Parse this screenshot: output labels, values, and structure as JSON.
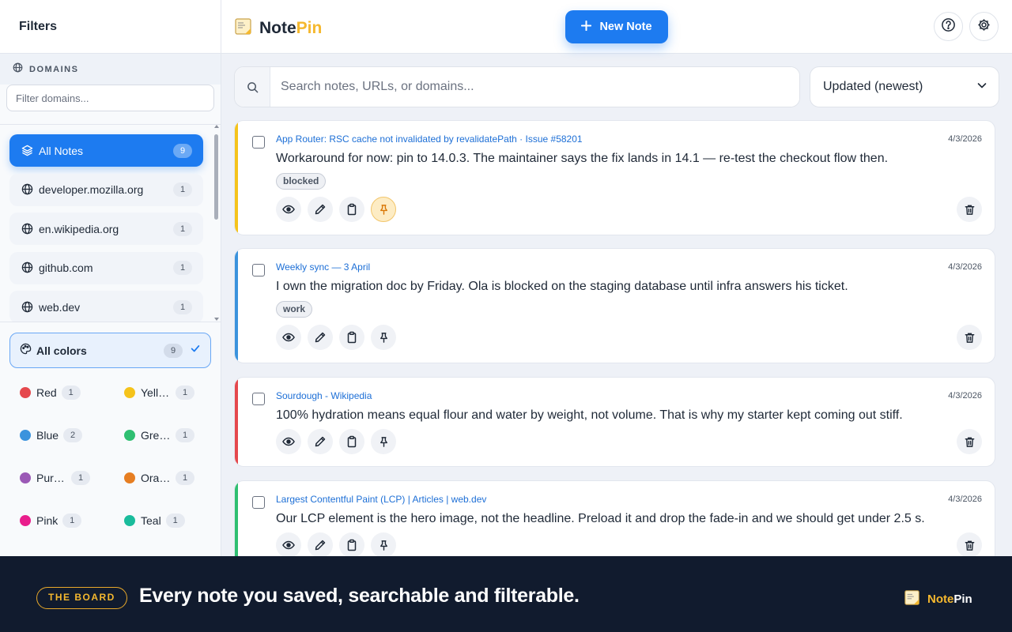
{
  "app": {
    "name_part1": "Note",
    "name_part2": "Pin"
  },
  "sidebar": {
    "title": "Filters",
    "domains_heading": "DOMAINS",
    "domain_filter_placeholder": "Filter domains...",
    "domains": [
      {
        "label": "All Notes",
        "count": "9",
        "active": true,
        "icon": "layers-icon"
      },
      {
        "label": "developer.mozilla.org",
        "count": "1",
        "icon": "globe-icon"
      },
      {
        "label": "en.wikipedia.org",
        "count": "1",
        "icon": "globe-icon"
      },
      {
        "label": "github.com",
        "count": "1",
        "icon": "globe-icon"
      },
      {
        "label": "web.dev",
        "count": "1",
        "icon": "globe-icon"
      }
    ],
    "all_colors": {
      "label": "All colors",
      "count": "9",
      "selected": true
    },
    "colors": [
      {
        "label": "Red",
        "count": "1",
        "hex": "#e5484d"
      },
      {
        "label": "Yellow",
        "count": "1",
        "hex": "#f5c31b"
      },
      {
        "label": "Blue",
        "count": "2",
        "hex": "#3b93dd"
      },
      {
        "label": "Green",
        "count": "1",
        "hex": "#2fbf71"
      },
      {
        "label": "Purple",
        "count": "1",
        "hex": "#9b59b6"
      },
      {
        "label": "Orange",
        "count": "1",
        "hex": "#e67e22"
      },
      {
        "label": "Pink",
        "count": "1",
        "hex": "#e91e8c"
      },
      {
        "label": "Teal",
        "count": "1",
        "hex": "#1abc9c"
      }
    ]
  },
  "toolbar": {
    "new_note_label": "New Note",
    "help_icon": "help-icon",
    "settings_icon": "gear-icon"
  },
  "search": {
    "placeholder": "Search notes, URLs, or domains...",
    "value": ""
  },
  "sort": {
    "selected": "Updated (newest)"
  },
  "notes": [
    {
      "source": "App Router: RSC cache not invalidated by revalidatePath · Issue #58201",
      "date": "4/3/2026",
      "text": "Workaround for now: pin to 14.0.3. The maintainer says the fix lands in 14.1 — re-test the checkout flow then.",
      "tag": "blocked",
      "color": "#f5c31b",
      "pinned": true
    },
    {
      "source": "Weekly sync — 3 April",
      "date": "4/3/2026",
      "text": "I own the migration doc by Friday. Ola is blocked on the staging database until infra answers his ticket.",
      "tag": "work",
      "color": "#3b93dd",
      "pinned": false
    },
    {
      "source": "Sourdough - Wikipedia",
      "date": "4/3/2026",
      "text": "100% hydration means equal flour and water by weight, not volume. That is why my starter kept coming out stiff.",
      "tag": "",
      "color": "#e5484d",
      "pinned": false
    },
    {
      "source": "Largest Contentful Paint (LCP) | Articles | web.dev",
      "date": "4/3/2026",
      "text": "Our LCP element is the hero image, not the headline. Preload it and drop the fade-in and we should get under 2.5 s.",
      "tag": "",
      "color": "#2fbf71",
      "pinned": false
    }
  ],
  "banner": {
    "badge": "THE BOARD",
    "tagline": "Every note you saved, searchable and filterable."
  }
}
